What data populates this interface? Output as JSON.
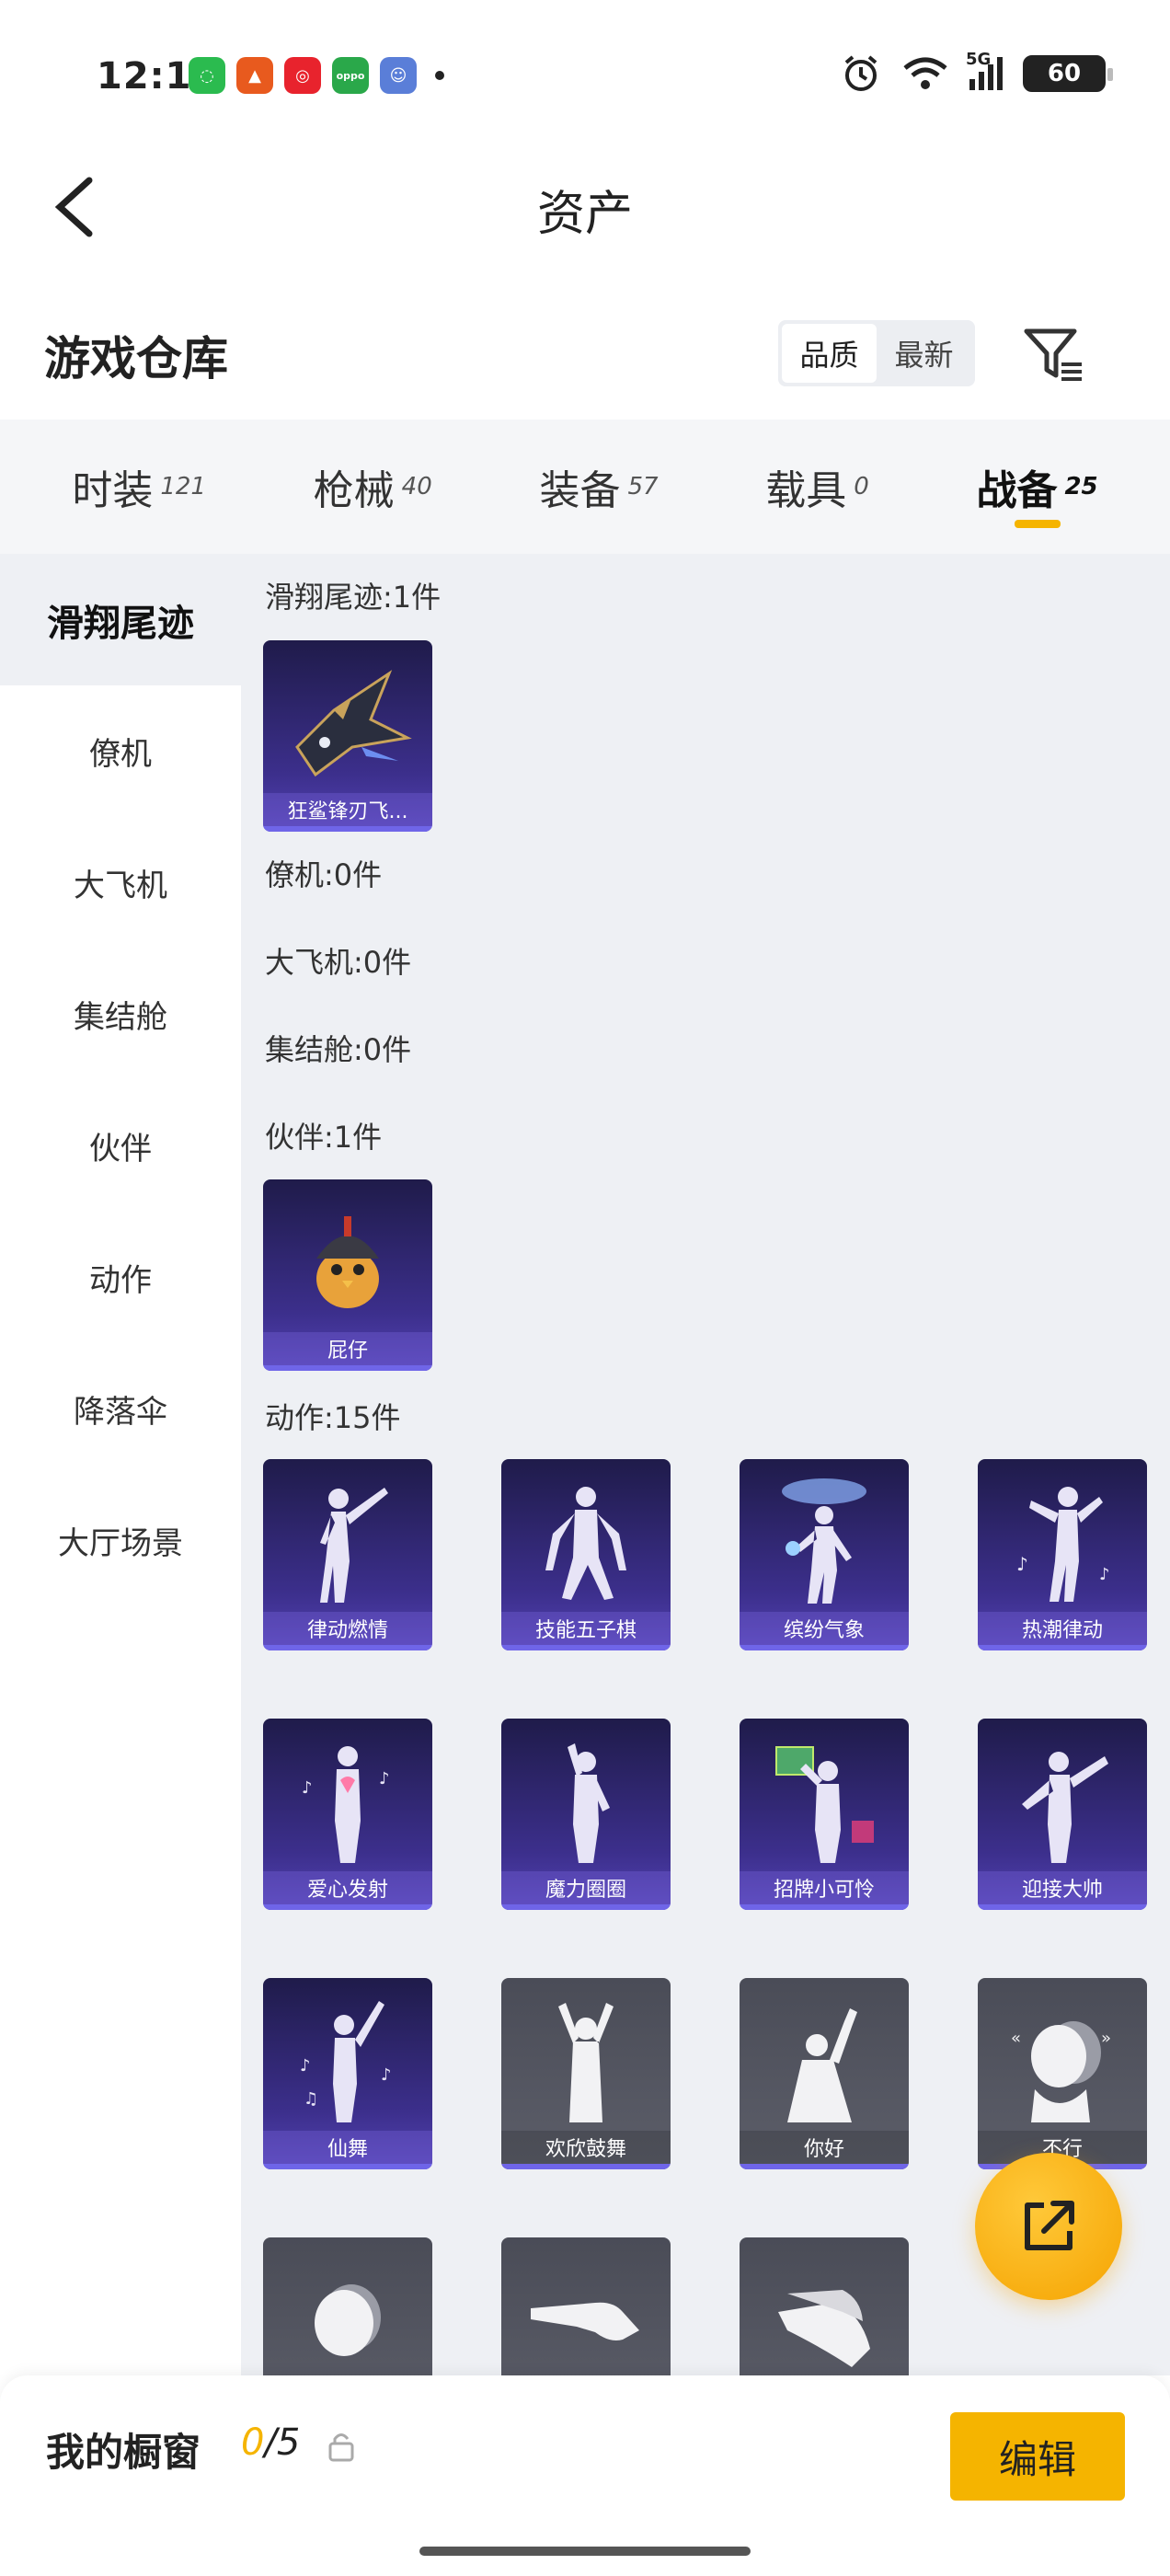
{
  "status_bar": {
    "time": "12:13",
    "battery": "60",
    "network": "5G"
  },
  "header": {
    "title": "资产"
  },
  "warehouse": {
    "title": "游戏仓库",
    "sort_options": [
      "品质",
      "最新"
    ]
  },
  "tabs": [
    {
      "label": "时装",
      "count": "121"
    },
    {
      "label": "枪械",
      "count": "40"
    },
    {
      "label": "装备",
      "count": "57"
    },
    {
      "label": "载具",
      "count": "0"
    },
    {
      "label": "战备",
      "count": "25"
    }
  ],
  "sidebar": [
    "滑翔尾迹",
    "僚机",
    "大飞机",
    "集结舱",
    "伙伴",
    "动作",
    "降落伞",
    "大厅场景"
  ],
  "sections": {
    "trail": {
      "label": "滑翔尾迹:1件",
      "items": [
        "狂鲨锋刃飞..."
      ]
    },
    "wingman": {
      "label": "僚机:0件"
    },
    "big_plane": {
      "label": "大飞机:0件"
    },
    "pod": {
      "label": "集结舱:0件"
    },
    "partner": {
      "label": "伙伴:1件",
      "items": [
        "屁仔"
      ]
    },
    "emote": {
      "label": "动作:15件",
      "items": [
        "律动燃情",
        "技能五子棋",
        "缤纷气象",
        "热潮律动",
        "爱心发射",
        "魔力圈圈",
        "招牌小可怜",
        "迎接大帅",
        "仙舞",
        "欢欣鼓舞",
        "你好",
        "不行"
      ]
    }
  },
  "bottom_bar": {
    "label": "我的橱窗",
    "current": "0",
    "total": "/5",
    "edit": "编辑"
  },
  "colors": {
    "accent": "#f5b400",
    "card_purple": "#3c2f8c",
    "card_gray": "#5c5e69"
  }
}
